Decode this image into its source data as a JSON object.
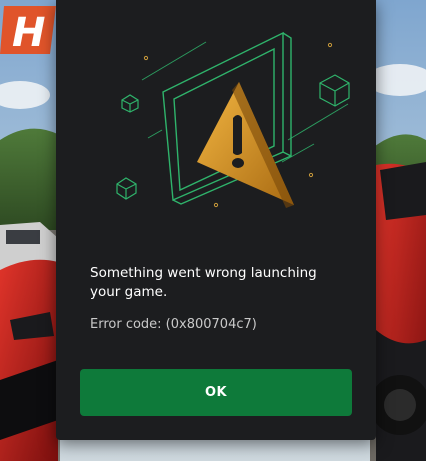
{
  "game_banner": {
    "logo_fragment": "H"
  },
  "dialog": {
    "message": "Something went wrong launching your game.",
    "error_code": "Error code: (0x800704c7)",
    "ok_label": "OK"
  },
  "colors": {
    "dialog_bg": "#1c1d1f",
    "button_bg": "#0e7a3a",
    "accent_green": "#2fb36b",
    "warning_gold": "#d89a2a"
  }
}
